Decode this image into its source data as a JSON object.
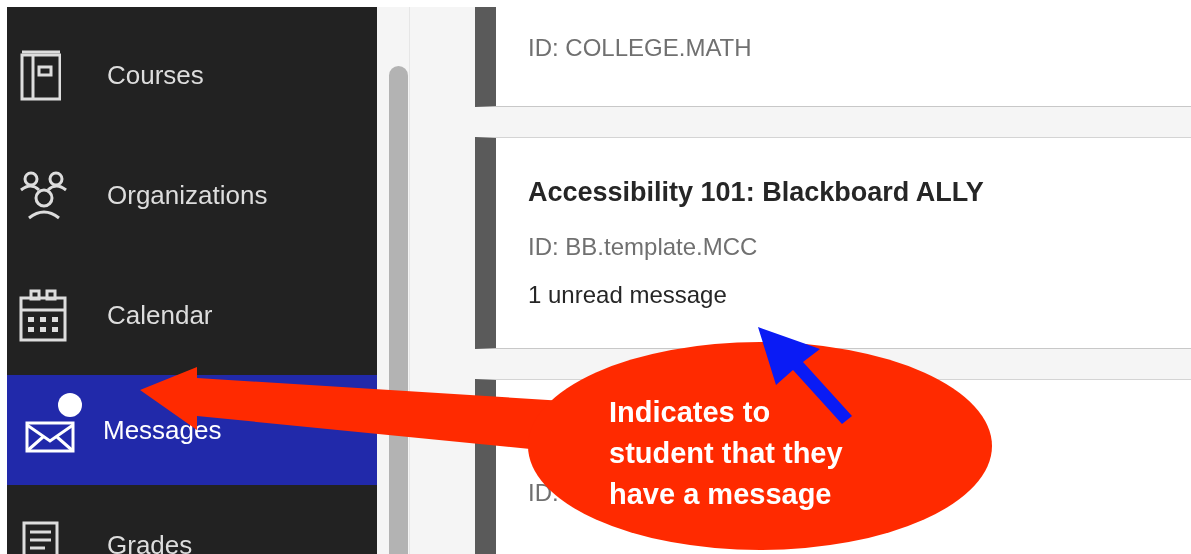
{
  "sidebar": {
    "items": [
      {
        "label": "Courses",
        "kind": "courses",
        "selected": false,
        "badge": false
      },
      {
        "label": "Organizations",
        "kind": "organizations",
        "selected": false,
        "badge": false
      },
      {
        "label": "Calendar",
        "kind": "calendar",
        "selected": false,
        "badge": false
      },
      {
        "label": "Messages",
        "kind": "messages",
        "selected": true,
        "badge": true
      },
      {
        "label": "Grades",
        "kind": "grades",
        "selected": false,
        "badge": false
      }
    ]
  },
  "cards": [
    {
      "id": "ID: COLLEGE.MATH"
    },
    {
      "title": "Accessibility 101: Blackboard ALLY",
      "id": "ID: BB.template.MCC",
      "note": "1 unread message"
    },
    {
      "id": "ID:"
    }
  ],
  "annotation": {
    "lines": [
      "Indicates to",
      "student that they",
      "have a message"
    ]
  }
}
